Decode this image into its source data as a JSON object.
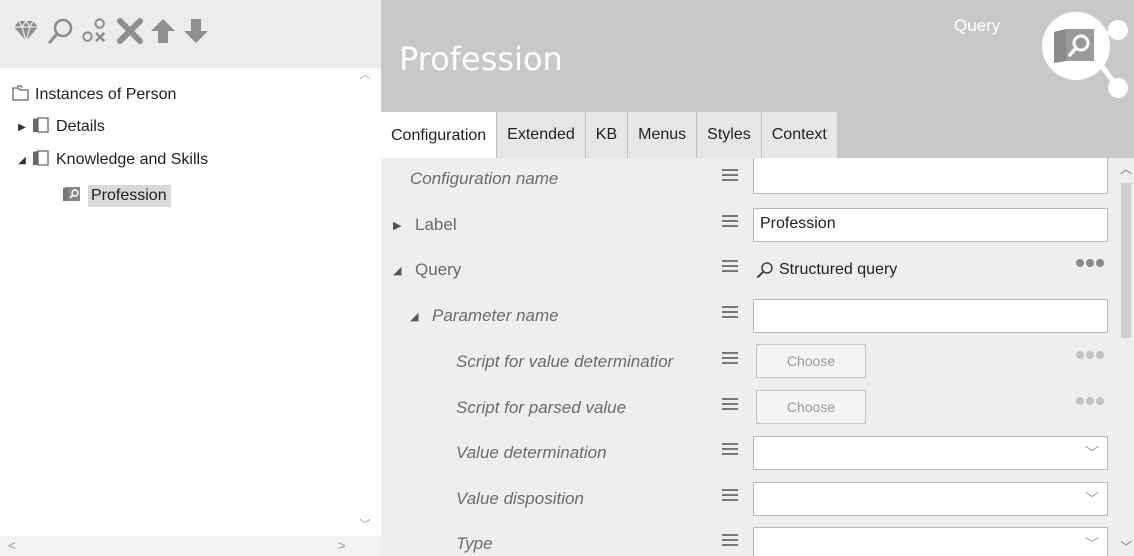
{
  "toolbar": {
    "icons": [
      "diamond-icon",
      "search-icon",
      "unlink-icon",
      "delete-icon",
      "arrow-up-icon",
      "arrow-down-icon"
    ]
  },
  "tree": {
    "items": [
      {
        "label": "Instances of Person",
        "level": 0
      },
      {
        "label": "Details",
        "level": 1,
        "expanded": false
      },
      {
        "label": "Knowledge and Skills",
        "level": 1,
        "expanded": true
      },
      {
        "label": "Profession",
        "level": 2,
        "selected": true
      }
    ]
  },
  "header": {
    "title": "Profession",
    "type_label": "Query"
  },
  "tabs": [
    "Configuration",
    "Extended",
    "KB",
    "Menus",
    "Styles",
    "Context"
  ],
  "active_tab": "Configuration",
  "properties": [
    {
      "name": "Configuration name",
      "value": ""
    },
    {
      "name": "Label",
      "value": "Profession"
    },
    {
      "name": "Query",
      "value": "Structured query"
    },
    {
      "name": "Parameter name",
      "value": ""
    },
    {
      "name": "Script for value determinatior",
      "button": "Choose"
    },
    {
      "name": "Script for parsed value",
      "button": "Choose"
    },
    {
      "name": "Value determination",
      "value": ""
    },
    {
      "name": "Value disposition",
      "value": ""
    },
    {
      "name": "Type",
      "value": ""
    }
  ],
  "colors": {
    "header_bg": "#c8c8c8",
    "toolbar_bg": "#ececec",
    "grid_bg": "#eeeeee"
  }
}
